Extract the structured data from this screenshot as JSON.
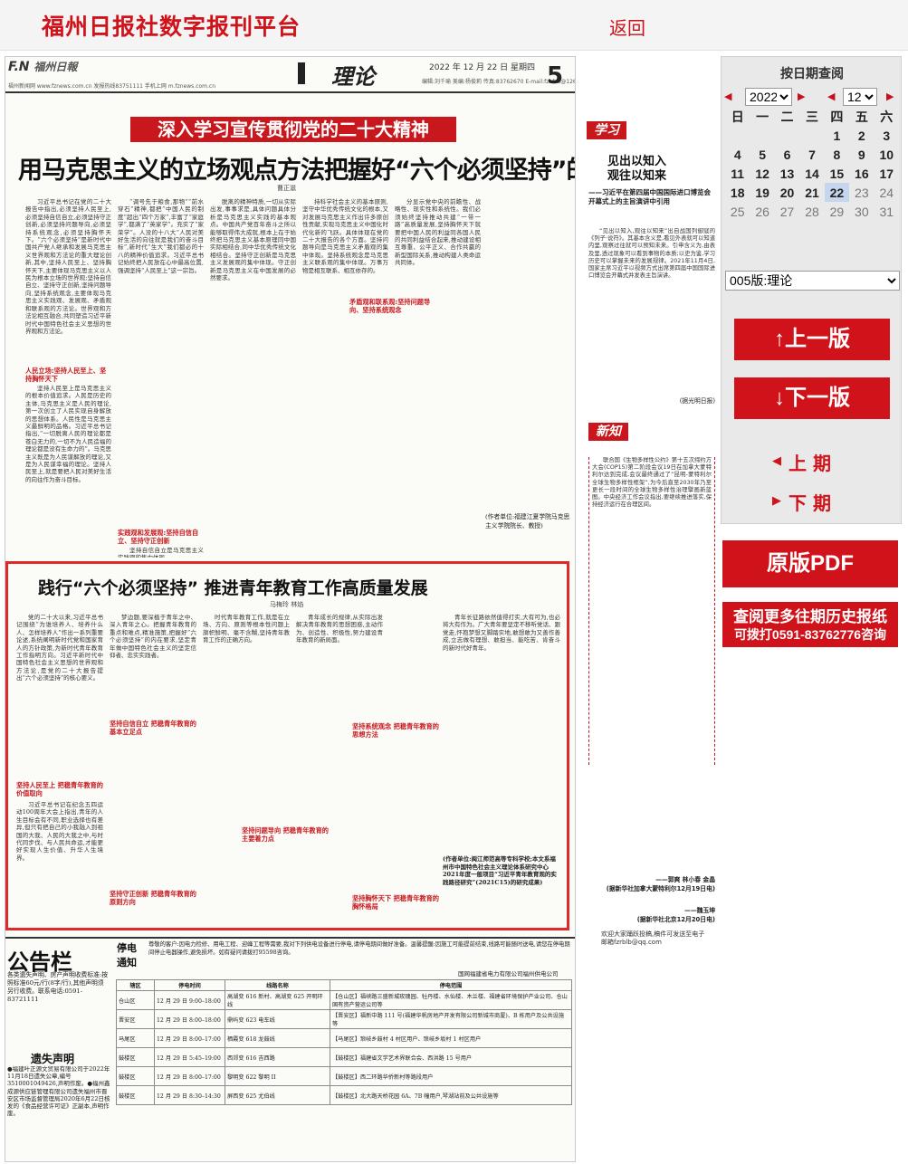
{
  "header": {
    "site_title": "福州日报社数字报刊平台",
    "back_label": "返回"
  },
  "paper": {
    "logo_mark": "F.N",
    "logo_name": "福州日報",
    "masthead_info": "福州新闻网 www.fznews.com.cn   发报热线83751111   手机上网 m.fznews.com.cn",
    "section_name": "理论",
    "date": "2022 年 12 月 22 日  星期四",
    "editor_line": "编辑:刘千瑜 美编:杨俊莉 传真:83762670 E-mail:fzbfzb@126.com",
    "page_no": "5",
    "kicker": "深入学习宣传贯彻党的二十大精神",
    "headline1": "用马克思主义的立场观点方法把握好“六个必须坚持”的内在逻辑",
    "author1": "曹正滋",
    "art1_col1": "习近平总书记在党的二十大报告中指出,必须坚持人民至上,必须坚持自信自立,必须坚持守正创新,必须坚持问题导向,必须坚持系统观念,必须坚持胸怀天下。“六个必须坚持”是新时代中国共产党人继承和发展马克思主义世界观和方法论的重大理论创新,其中,坚持人民至上、坚持胸怀天下,主要体现马克思主义以人民为根本立场的世界观;坚持自信自立、坚持守正创新,坚持问题导向,坚持系统观念,主要体现马克思主义实践观、发展观、矛盾观和联系观的方法论。世界观和方法论相互融合,共同塑造习近平新时代中国特色社会主义思想的世界观和方法论。",
    "art1_sub1": "人民立场:坚持人民至上、坚持胸怀天下",
    "art1_col1b": "坚持人民至上是马克思主义的根本价值追求。人民是历史的主体,马克思主义是人民的理论,第一次创立了人民实现自身解放的思想体系。人民性是马克思主义最鲜明的品格。习近平总书记指出,“一切脱离人民的理论都是苍白无力的,一切不为人民造福的理论都是没有生命力的”。马克思主义既是为人民谋解放的理论,又是为人民谋幸福的理论。坚持人民至上,就是要把人民对美好生活的向往作为奋斗目标。",
    "art1_col2": "“调号先于粮食,那物”“前水穿石”精神,都把“中国人民的制度”超出“四个万家”,丰富了“家庭学”,都满了“英家学”。充实了“家荣学”。人没的十八大“人民对美好生活的向往就是我们的奋斗目标”,新时代“生大”我们都必的十八的精神价值追求。习近平总书记始终把人民放在心中最高位置,强调坚持“人民至上”这一宗旨。",
    "art1_sub2": "实践观和发展观:坚持自信自立、坚持守正创新",
    "art1_col2b": "坚持自信自立是马克思主义实践观的集中体现。",
    "art1_col3": "脱离的精神特质,一切从实际出发,事事求是,具体问题具体分析是马克思主义实践的基本观点。中国共产党百年奋斗之所以能够取得伟大成就,根本上在于始终把马克思主义基本原理同中国实际相结合,同中华优秀传统文化相结合。坚持守正创新是马克思主义发展观的集中体现。守正创新是马克思主义在中国发展的必然要求。",
    "art1_sub3": "矛盾观和联系观:坚持问题导向、坚持系统观念",
    "art1_col4": "持科学社会主义的基本原则,坚守中华优秀传统文化的根本,又对发展马克思主义作出许多原创性贡献,实现马克思主义中国化时代化新的飞跃。具体体现在党的二十大报告的各个方面。坚持问题导向是马克思主义矛盾观的集中体现。坚持系统观念是马克思主义联系观的集中体现。万事万物是相互联系、相互依存的。",
    "art1_col5": "分显示党中央的前瞻性、战略性、现实性和系统性。我们必须始终坚持推动共建“一带一路”高质量发展,坚持胸怀天下就要把中国人民的利益同各国人民的共同利益结合起来,推动建设相互尊重、公平正义、合作共赢的新型国际关系,推动构建人类命运共同体。",
    "art1_byline": "(作者单位:福建江夏学院马克思主义学院院长、教授)",
    "study_tag": "学习",
    "side_title1": "见出以知入\n观往以知来",
    "side_sub1": "——习近平在第四届中国国际进口博览会开幕式上的主旨演讲中引用",
    "side_text1": "“见出以知入,观往以知来”出自战国列御寇的《列子·说符》。其基本含义是,看见外表就可以知道内里,观察过往就可以预知未来。引申含义为,由表及里,透过现象可以看到事物的本质;以史为鉴,学习历史可以掌握未来的发展规律。2021年11月4日,国家主席习近平以视频方式出席第四届中国国际进口博览会开幕式并发表主旨演讲。",
    "side_src1": "(据光明日报)",
    "xinzhi_tag": "新知",
    "side_text2": "联合国《生物多样性公约》第十五次缔约方大会(COP15)第二阶段会议19日在加拿大蒙特利尔达到完成,会议最终通过了“昆明-蒙特利尔全球生物多样性框架”,为今后直至2030年乃至更长一段时间的全球生物多样性治理擘画新蓝图。中央经济工作会议指出,要继续推进落实,保持经济运行在合理区间。",
    "side_src2": "——郭爽 林小春 金晶\n(据新华社加拿大蒙特利尔12月19日电)",
    "side_src3": "——魏玉坤\n(据新华社北京12月20日电)",
    "contact_note": "欢迎大家踊跃投稿,稿件可发送至电子邮箱fzrblb@qq.com",
    "headline2": "践行“六个必须坚持” 推进青年教育工作高质量发展",
    "author2": "马梅玲 林焰",
    "art2_col1": "党的二十大以来,习近平总书记围绕“为谁培养人、培养什么人、怎样培养人”作出一系列重要论述,系统阐明新时代党和国家育人的方针政策,为新时代青年教育工作指明方向。习近平新时代中国特色社会主义思想的世界观和方法论,是党的二十大报告提出“六个必须坚持”的核心要义。",
    "art2_sub1": "坚持人民至上 把稳青年教育的价值取向",
    "art2_col1b": "习近平总书记在纪念五四运动100周年大会上指出,青年的人生目标会有不同,职业选择也有差异,但只有把自己的小我融入到祖国的大我、人民的大我之中,与时代同步伐、与人民共命运,才能更好实现人生价值、升华人生境界。",
    "art2_col2": "梦边题,要深植于青年之中、深入青年之心。把握青年教育的重点和难点,精准施策,把握好“六个必须坚持”的内在要求,坚定青年做中国特色社会主义的坚定信仰者、忠实实践者。",
    "art2_sub2": "坚持自信自立 把稳青年教育的基本立足点",
    "art2_sub3": "坚持守正创新 把稳青年教育的原则方向",
    "art2_col3": "时代青年教育工作,就是在立场、方向、原则等根本性问题上旗帜鲜明、毫不含糊,坚持青年教育工作的正确方向。",
    "art2_sub4": "坚持问题导向 把稳青年教育的主要着力点",
    "art2_col4": "青年成长的规律,从实际出发解决青年教育的思想困惑,主动作为、创造性、积极性,努力建设青年教育的新局面。",
    "art2_sub5": "坚持系统观念 把稳青年教育的思想方法",
    "art2_sub6": "坚持胸怀天下 把稳青年教育的胸怀格局",
    "art2_col5": "青年长征路依然值得打实,大有可为,也必将大有作为。广大青年要坚定不移听党话、跟党走,怀抱梦想又脚踏实地,敢想敢为又善作善成,立志做有理想、敢担当、能吃苦、肯奋斗的新时代好青年。",
    "art2_byline": "(作者单位:闽江师范高等专科学校;本文系福州市中国特色社会主义理论体系研究中心2021年度一般项目“习近平青年教育观的实践路径研究”(2021C15)的研究成果)",
    "ads_title": "公告栏",
    "ads_sub": "各类遗失声明、房产声明收费标准:按照标准60元/行(8字/行),其他声明须另行收费。联系电话:0591-83721111",
    "lost_title": "遗失声明",
    "lost_text": "●福建叶正源文贸易有限公司于2022年11月18日遗失公章,编号3510001049426,声明作废。●福州鑫成源供应链管理有限公司遗失福州市晋安区市场监督管理局2020年6月22日核发的《食品经营许可证》正副本,声明作废。",
    "outage_label": "停电通知",
    "outage_note": "尊敬的客户:因电力检修、用电工程、迎峰工程等需要,我对下列供电设备进行停电,请停电期间做好准备。温馨提醒:因施工可能提前结束,线路可能随时送电,请您在停电期间停止电器操作,避免损坏。如有疑问请拨打95598咨询。",
    "outage_sign": "国网福建省电力有限公司福州供电公司",
    "outage_table": {
      "headers": [
        "辖区",
        "停电时间",
        "线路名称",
        "停电范围"
      ],
      "rows": [
        [
          "仓山区",
          "12 月 29 日  9:00–18:00",
          "高湖变 616 新村、高湖变 625 开明环线",
          "【仓山区】福峡路三盛新城玫瑰园、牡丹楼、水仙楼、木兰楼、福建省环境保护产业公司、仓山国有资产营运公司等"
        ],
        [
          "晋安区",
          "12 月 29 日  8:00–18:00",
          "鼎屿变 623 电车线",
          "【晋安区】福新中路 111 号(福建华帆房地产开发有限公司新城市商厦)、B 栋用户及公共设施等"
        ],
        [
          "马尾区",
          "12 月 29 日  8:00–17:00",
          "栖霞变 618 龙鼓线",
          "【马尾区】琅岐乡鼓村 4 村区用户、琅岐乡坂村 1 村区用户"
        ],
        [
          "鼓楼区",
          "12 月 29 日  5:45–19:00",
          "西郊变 616 吉西路",
          "【鼓楼区】福建省文学艺术界联合会、西洪路 15 号用户"
        ],
        [
          "鼓楼区",
          "12 月 29 日  8:00–17:00",
          "黎明变 622 黎明 II",
          "【鼓楼区】西二环路华侨新村等路段用户"
        ],
        [
          "鼓楼区",
          "12 月 29 日  8:30–14:30",
          "屏西变 625 尤伯线",
          "【鼓楼区】北大路天桥花园 6A、7B 幢用户,琴湖站前及公共设施等"
        ]
      ]
    }
  },
  "sidebar": {
    "calendar_title": "按日期查阅",
    "year": "2022",
    "month": "12",
    "weekdays": [
      "日",
      "一",
      "二",
      "三",
      "四",
      "五",
      "六"
    ],
    "weeks": [
      [
        "",
        "",
        "",
        "",
        "1",
        "2",
        "3"
      ],
      [
        "4",
        "5",
        "6",
        "7",
        "8",
        "9",
        "10"
      ],
      [
        "11",
        "12",
        "13",
        "14",
        "15",
        "16",
        "17"
      ],
      [
        "18",
        "19",
        "20",
        "21",
        "22",
        "23",
        "24"
      ],
      [
        "25",
        "26",
        "27",
        "28",
        "29",
        "30",
        "31"
      ]
    ],
    "selected_day": "22",
    "edition": "005版:理论",
    "prev_page": "上一版",
    "next_page": "下一版",
    "prev_issue": "上 期",
    "next_issue": "下 期",
    "pdf_label": "原版PDF",
    "history_line1": "查阅更多往期历史报纸",
    "history_line2": "可拨打0591-83762776咨询"
  },
  "colors": {
    "brand_red": "#d0121b",
    "kicker_red": "#c8181d",
    "highlight_border": "#e02a2a",
    "selected_day_bg": "#c6d6ee"
  },
  "icons": {
    "prev_arrow": "triangle-left",
    "next_arrow": "triangle-right",
    "up_arrow": "arrow-up",
    "down_arrow": "arrow-down"
  }
}
